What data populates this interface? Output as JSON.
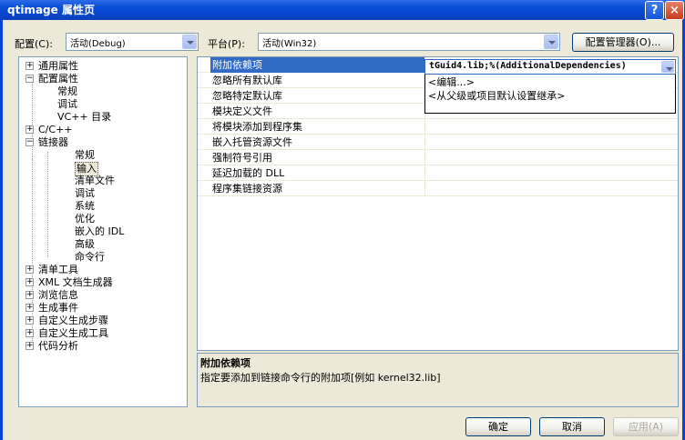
{
  "window": {
    "title": "qtimage 属性页"
  },
  "titlebar": {
    "help": "?",
    "close": "×"
  },
  "toolbar": {
    "config_label": "配置(C):",
    "config_value": "活动(Debug)",
    "platform_label": "平台(P):",
    "platform_value": "活动(Win32)",
    "config_manager": "配置管理器(O)..."
  },
  "tree": {
    "items": [
      {
        "label": "通用属性",
        "expander": "+"
      },
      {
        "label": "配置属性",
        "expander": "−"
      },
      {
        "label": "常规"
      },
      {
        "label": "调试"
      },
      {
        "label": "VC++ 目录"
      },
      {
        "label": "C/C++",
        "expander": "+"
      },
      {
        "label": "链接器",
        "expander": "−"
      },
      {
        "label": "常规"
      },
      {
        "label": "输入"
      },
      {
        "label": "清单文件"
      },
      {
        "label": "调试"
      },
      {
        "label": "系统"
      },
      {
        "label": "优化"
      },
      {
        "label": "嵌入的 IDL"
      },
      {
        "label": "高级"
      },
      {
        "label": "命令行"
      },
      {
        "label": "清单工具",
        "expander": "+"
      },
      {
        "label": "XML 文档生成器",
        "expander": "+"
      },
      {
        "label": "浏览信息",
        "expander": "+"
      },
      {
        "label": "生成事件",
        "expander": "+"
      },
      {
        "label": "自定义生成步骤",
        "expander": "+"
      },
      {
        "label": "自定义生成工具",
        "expander": "+"
      },
      {
        "label": "代码分析",
        "expander": "+"
      }
    ]
  },
  "grid": {
    "rows": [
      {
        "name": "附加依赖项",
        "value": "tGuid4.lib;%(AdditionalDependencies)"
      },
      {
        "name": "忽略所有默认库",
        "value": ""
      },
      {
        "name": "忽略特定默认库",
        "value": ""
      },
      {
        "name": "模块定义文件",
        "value": ""
      },
      {
        "name": "将模块添加到程序集",
        "value": ""
      },
      {
        "name": "嵌入托管资源文件",
        "value": ""
      },
      {
        "name": "强制符号引用",
        "value": ""
      },
      {
        "name": "延迟加载的 DLL",
        "value": ""
      },
      {
        "name": "程序集链接资源",
        "value": ""
      }
    ]
  },
  "dropdown": {
    "items": [
      "<编辑...>",
      "<从父级或项目默认设置继承>"
    ]
  },
  "description": {
    "title": "附加依赖项",
    "text": "指定要添加到链接命令行的附加项[例如 kernel32.lib]"
  },
  "buttons": {
    "ok": "确定",
    "cancel": "取消",
    "apply": "应用(A)"
  }
}
